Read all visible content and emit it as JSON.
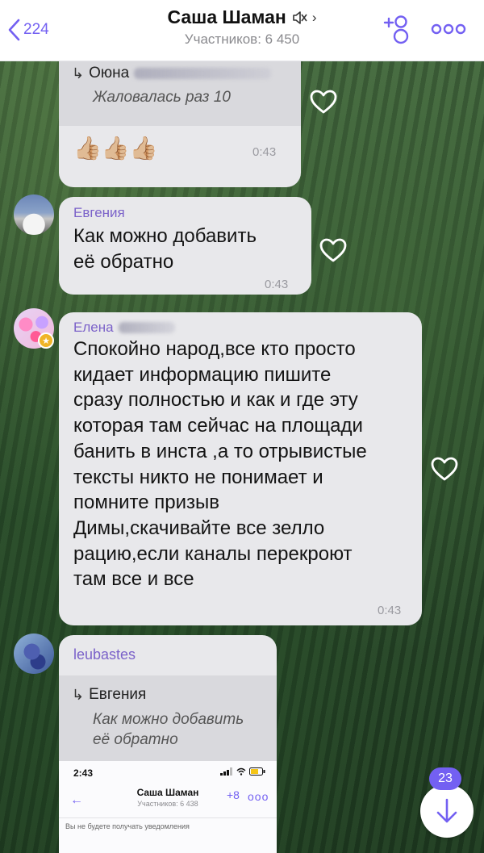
{
  "header": {
    "back_count": "224",
    "title": "Саша Шаман",
    "chevron": "›",
    "participants": "Участников: 6 450",
    "icons": {
      "back": "chevron-left-icon",
      "muted": "speaker-muted-icon",
      "add": "add-participant-icon",
      "more": "more-dots-icon"
    },
    "accent_color": "#7360f2"
  },
  "messages": [
    {
      "reply": {
        "name": "Оюна",
        "text": "Жаловалась раз 10"
      },
      "emoji": "👍🏼👍🏼👍🏼",
      "time": "0:43"
    },
    {
      "sender": "Евгения",
      "text_lines": [
        "Как можно добавить",
        "её обратно"
      ],
      "time": "0:43"
    },
    {
      "sender": "Елена",
      "text_lines": [
        "Спокойно народ,все кто просто",
        "кидает информацию пишите",
        "сразу полностью и как и где эту",
        "которая там сейчас на площади",
        "банить в инста ,а то отрывистые",
        "тексты никто не понимает и",
        "помните призыв",
        "Димы,скачивайте все зелло",
        "рацию,если каналы перекроют",
        "там все и все"
      ],
      "time": "0:43"
    },
    {
      "sender": "leubastes",
      "reply": {
        "name": "Евгения",
        "text_lines": [
          "Как можно добавить",
          "её обратно"
        ]
      },
      "screenshot": {
        "time": "2:43",
        "title": "Саша Шаман",
        "subtitle": "Участников: 6 438",
        "notice": "Вы не будете получать уведомления"
      }
    }
  ],
  "unread_badge": "23",
  "scroll_down_icon": "arrow-down-icon"
}
